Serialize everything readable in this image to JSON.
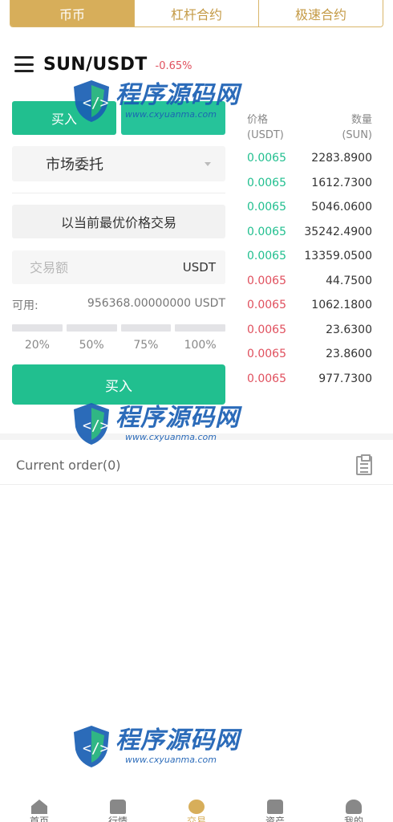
{
  "top_tabs": [
    {
      "label": "币币",
      "active": true
    },
    {
      "label": "杠杆合约",
      "active": false
    },
    {
      "label": "极速合约",
      "active": false
    }
  ],
  "header": {
    "pair": "SUN/USDT",
    "change": "-0.65%",
    "menu_icon": "hamburger-menu-icon"
  },
  "trade": {
    "buy_tab": "买入",
    "sell_tab": "",
    "order_type": "市场委托",
    "best_price_note": "以当前最优价格交易",
    "amount_placeholder": "交易额",
    "amount_unit": "USDT",
    "available_label": "可用:",
    "available_value": "956368.00000000 USDT",
    "percents": [
      "20%",
      "50%",
      "75%",
      "100%"
    ],
    "submit": "买入"
  },
  "order_book": {
    "price_label": "价格",
    "price_unit": "(USDT)",
    "qty_label": "数量",
    "qty_unit": "(SUN)",
    "rows": [
      {
        "price": "0.0065",
        "qty": "2283.8900",
        "side": "buy"
      },
      {
        "price": "0.0065",
        "qty": "1612.7300",
        "side": "buy"
      },
      {
        "price": "0.0065",
        "qty": "5046.0600",
        "side": "buy"
      },
      {
        "price": "0.0065",
        "qty": "35242.4900",
        "side": "buy"
      },
      {
        "price": "0.0065",
        "qty": "13359.0500",
        "side": "buy"
      },
      {
        "price": "0.0065",
        "qty": "44.7500",
        "side": "sell"
      },
      {
        "price": "0.0065",
        "qty": "1062.1800",
        "side": "sell"
      },
      {
        "price": "0.0065",
        "qty": "23.6300",
        "side": "sell"
      },
      {
        "price": "0.0065",
        "qty": "23.8600",
        "side": "sell"
      },
      {
        "price": "0.0065",
        "qty": "977.7300",
        "side": "sell"
      }
    ]
  },
  "current_order": {
    "label": "Current order(0)",
    "icon": "clipboard-icon"
  },
  "watermark": {
    "cn": "程序源码网",
    "url": "www.cxyuanma.com"
  },
  "bottom_nav": [
    {
      "label": "首页",
      "icon": "home-icon",
      "active": false
    },
    {
      "label": "行情",
      "icon": "chart-icon",
      "active": false
    },
    {
      "label": "交易",
      "icon": "trade-icon",
      "active": true
    },
    {
      "label": "资产",
      "icon": "wallet-icon",
      "active": false
    },
    {
      "label": "我的",
      "icon": "user-icon",
      "active": false
    }
  ],
  "colors": {
    "gold": "#d7ae5a",
    "green": "#21bf8f",
    "red": "#e0505e"
  }
}
